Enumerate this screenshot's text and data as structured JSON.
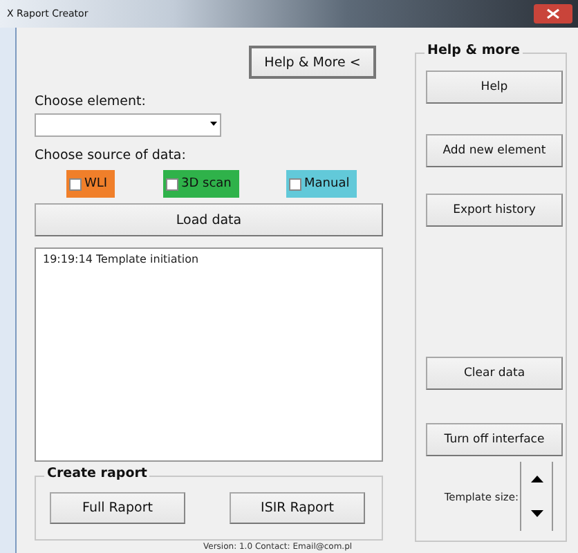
{
  "window": {
    "title": "X Raport Creator"
  },
  "toggle_button": "Help & More <",
  "element_label": "Choose element:",
  "source_label": "Choose source of data:",
  "sources": [
    {
      "label": "WLI",
      "checked": false,
      "color": "#f07f2a"
    },
    {
      "label": "3D scan",
      "checked": false,
      "color": "#2fb24a"
    },
    {
      "label": "Manual",
      "checked": false,
      "color": "#62c9d9"
    }
  ],
  "load_button": "Load data",
  "log": [
    "19:19:14  Template initiation"
  ],
  "create_group": {
    "title": "Create raport",
    "buttons": [
      "Full Raport",
      "ISIR Raport"
    ]
  },
  "footer": "Version: 1.0 Contact: Email@com.pl",
  "help_group": {
    "title": "Help & more",
    "buttons": [
      "Help",
      "Add new element",
      "Export history",
      "Clear data",
      "Turn off interface"
    ],
    "spinner_label": "Template size:"
  }
}
